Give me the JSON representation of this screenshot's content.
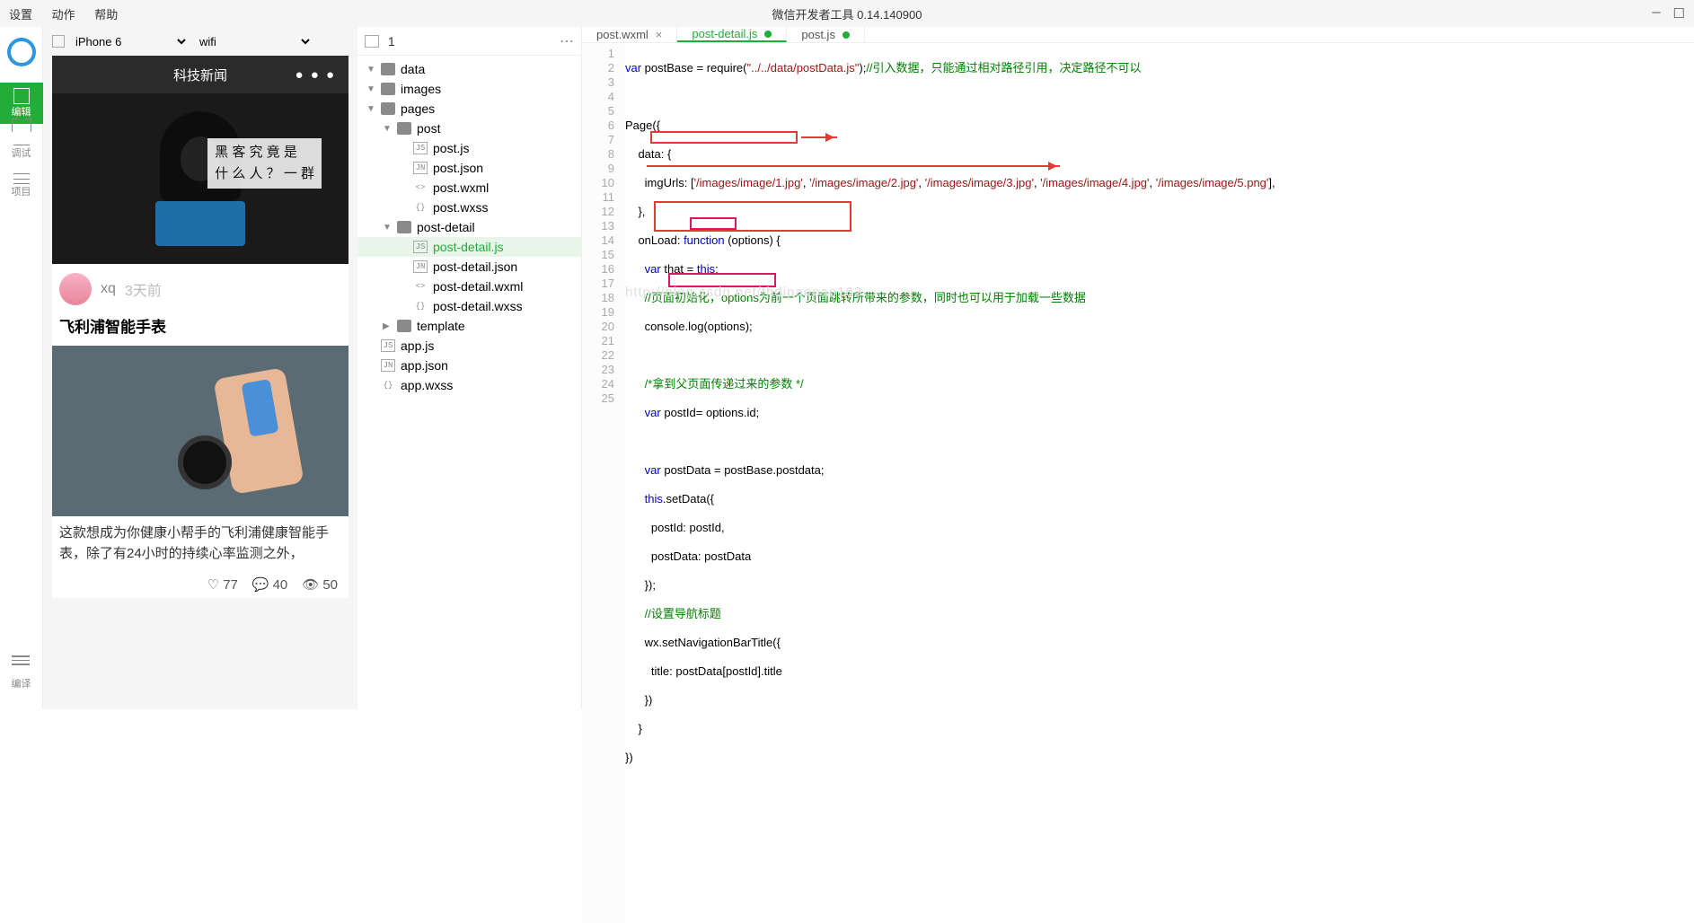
{
  "menubar": {
    "items": [
      "设置",
      "动作",
      "帮助"
    ]
  },
  "window": {
    "title": "微信开发者工具 0.14.140900"
  },
  "rail": {
    "items": [
      {
        "id": "edit",
        "label": "编辑"
      },
      {
        "id": "debug",
        "label": "调试"
      },
      {
        "id": "project",
        "label": "项目"
      }
    ],
    "bottom_label": "编译"
  },
  "phone": {
    "device": "iPhone 6",
    "network": "wifi",
    "header": "科技新闻",
    "more": "● ● ●",
    "overlay_l1": "黑 客 究 竟 是",
    "overlay_l2": "什 么 人 ？ 一 群",
    "meta_name": "xq",
    "meta_time": "3天前",
    "title": "飞利浦智能手表",
    "desc": "这款想成为你健康小帮手的飞利浦健康智能手表，除了有24小时的持续心率监测之外，",
    "stats": {
      "like": "77",
      "comment": "40",
      "view": "50"
    }
  },
  "tree_hdr": {
    "num": "1"
  },
  "tree": [
    {
      "d": 0,
      "t": "folder",
      "open": true,
      "label": "data"
    },
    {
      "d": 0,
      "t": "folder",
      "open": true,
      "label": "images"
    },
    {
      "d": 0,
      "t": "folder",
      "open": true,
      "label": "pages"
    },
    {
      "d": 1,
      "t": "folder",
      "open": true,
      "label": "post"
    },
    {
      "d": 2,
      "t": "js",
      "label": "post.js"
    },
    {
      "d": 2,
      "t": "json",
      "label": "post.json"
    },
    {
      "d": 2,
      "t": "wxml",
      "label": "post.wxml"
    },
    {
      "d": 2,
      "t": "wxss",
      "label": "post.wxss"
    },
    {
      "d": 1,
      "t": "folder",
      "open": true,
      "label": "post-detail"
    },
    {
      "d": 2,
      "t": "js",
      "label": "post-detail.js",
      "sel": true
    },
    {
      "d": 2,
      "t": "json",
      "label": "post-detail.json"
    },
    {
      "d": 2,
      "t": "wxml",
      "label": "post-detail.wxml"
    },
    {
      "d": 2,
      "t": "wxss",
      "label": "post-detail.wxss"
    },
    {
      "d": 1,
      "t": "folder",
      "open": false,
      "label": "template"
    },
    {
      "d": 0,
      "t": "js",
      "label": "app.js"
    },
    {
      "d": 0,
      "t": "json",
      "label": "app.json"
    },
    {
      "d": 0,
      "t": "wxss",
      "label": "app.wxss"
    }
  ],
  "tabs": [
    {
      "label": "post.wxml",
      "close": true
    },
    {
      "label": "post-detail.js",
      "active": true,
      "dirty": true
    },
    {
      "label": "post.js",
      "dirty": true
    }
  ],
  "code": {
    "l1a": "var",
    "l1b": " postBase = require(",
    "l1c": "\"../../data/postData.js\"",
    "l1d": ");",
    "l1e": "//引入数据，只能通过相对路径引用，决定路径不可以",
    "l3": "Page({",
    "l4a": "    data: {",
    "l5a": "      imgUrls: [",
    "l5b": "'/images/image/1.jpg'",
    "l5c": ", ",
    "l5d": "'/images/image/2.jpg'",
    "l5e": ", ",
    "l5f": "'/images/image/3.jpg'",
    "l5g": ", ",
    "l5h": "'/images/image/4.jpg'",
    "l5i": ", ",
    "l5j": "'/images/image/5.png'",
    "l5k": "],",
    "l6": "    },",
    "l7a": "    onLoad: ",
    "l7b": "function",
    "l7c": " (options) {",
    "l8a": "      var",
    "l8b": " that = ",
    "l8c": "this",
    "l8d": ";",
    "l9": "      //页面初始化，options为前一个页面跳转所带来的参数，同时也可以用于加载一些数据",
    "l10": "      console.log(options);",
    "l12": "      /*拿到父页面传递过来的参数 */",
    "l13a": "      var",
    "l13b": " postId=",
    "l13c": " options.id;",
    "l15a": "      var",
    "l15b": " postData = postBase.postdata;",
    "l16a": "      this",
    "l16b": ".setData({",
    "l17": "        postId: postId,",
    "l18": "        postData: postData",
    "l19": "      });",
    "l20": "      //设置导航标题",
    "l21": "      wx.setNavigationBarTitle({",
    "l22": "        title: postData[postId].title",
    "l23": "      })",
    "l24": "    }",
    "l25": "})",
    "watermark": "http://blog.csdn.net/thdipaopao163"
  }
}
